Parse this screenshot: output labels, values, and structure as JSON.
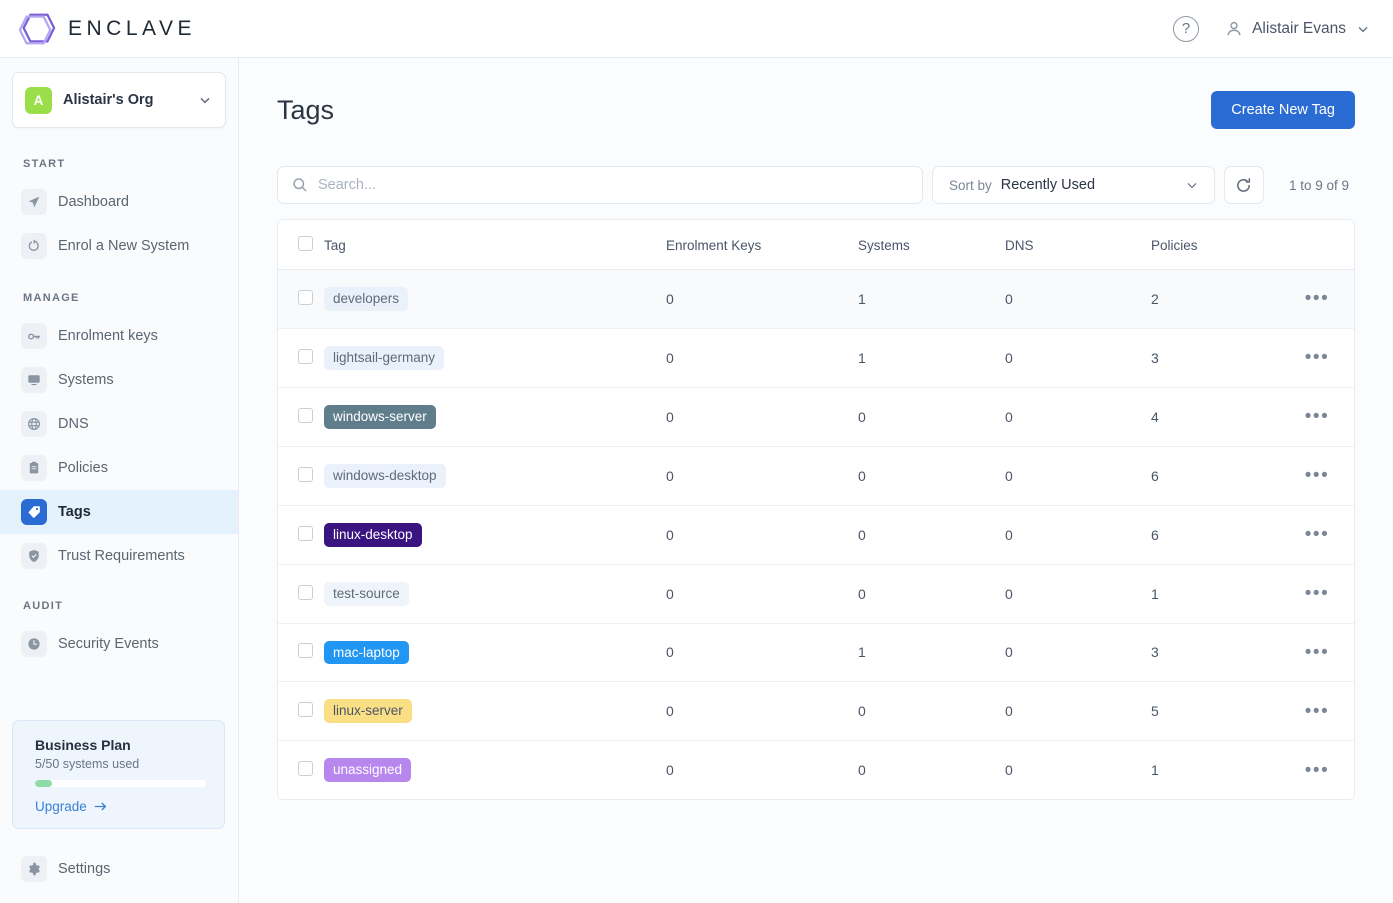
{
  "topbar": {
    "logo_text": "ENCLAVE",
    "logo_icon": "hexagon-logo-icon",
    "help_icon": "help-circle-icon",
    "user_icon": "user-avatar-icon",
    "user_name": "Alistair Evans",
    "chevron_icon": "chevron-down-icon"
  },
  "sidebar": {
    "org": {
      "avatar_letter": "A",
      "name": "Alistair's Org"
    },
    "sections": [
      {
        "label": "START",
        "items": [
          {
            "label": "Dashboard",
            "icon": "navigation-arrow-icon",
            "active": false
          },
          {
            "label": "Enrol a New System",
            "icon": "enrol-system-icon",
            "active": false
          }
        ]
      },
      {
        "label": "MANAGE",
        "items": [
          {
            "label": "Enrolment keys",
            "icon": "key-icon",
            "active": false
          },
          {
            "label": "Systems",
            "icon": "monitor-icon",
            "active": false
          },
          {
            "label": "DNS",
            "icon": "globe-icon",
            "active": false
          },
          {
            "label": "Policies",
            "icon": "clipboard-icon",
            "active": false
          },
          {
            "label": "Tags",
            "icon": "tag-icon",
            "active": true
          },
          {
            "label": "Trust Requirements",
            "icon": "shield-check-icon",
            "active": false
          }
        ]
      },
      {
        "label": "AUDIT",
        "items": [
          {
            "label": "Security Events",
            "icon": "clock-icon",
            "active": false
          }
        ]
      }
    ],
    "plan": {
      "title": "Business Plan",
      "usage": "5/50 systems used",
      "progress_percent": 10,
      "upgrade_label": "Upgrade",
      "upgrade_icon": "arrow-right-icon",
      "bar_color": "#8fdba5"
    },
    "settings": {
      "label": "Settings",
      "icon": "gear-icon"
    }
  },
  "main": {
    "title": "Tags",
    "create_button": "Create New Tag",
    "search": {
      "placeholder": "Search...",
      "value": "",
      "icon": "search-icon"
    },
    "sort": {
      "label": "Sort by",
      "value": "Recently Used",
      "icon": "chevron-down-icon"
    },
    "refresh_icon": "refresh-icon",
    "pagination": "1 to 9 of 9",
    "table": {
      "columns": [
        "Tag",
        "Enrolment Keys",
        "Systems",
        "DNS",
        "Policies"
      ],
      "rows": [
        {
          "tag": "developers",
          "enrolment_keys": "0",
          "systems": "1",
          "dns": "0",
          "policies": "2",
          "pill_bg": "#eaf1fb",
          "pill_fg": "#5f6b7a",
          "hovered": true
        },
        {
          "tag": "lightsail-germany",
          "enrolment_keys": "0",
          "systems": "1",
          "dns": "0",
          "policies": "3",
          "pill_bg": "#eaf1fb",
          "pill_fg": "#5f6b7a",
          "hovered": false
        },
        {
          "tag": "windows-server",
          "enrolment_keys": "0",
          "systems": "0",
          "dns": "0",
          "policies": "4",
          "pill_bg": "#607d8b",
          "pill_fg": "#ffffff",
          "hovered": false
        },
        {
          "tag": "windows-desktop",
          "enrolment_keys": "0",
          "systems": "0",
          "dns": "0",
          "policies": "6",
          "pill_bg": "#eaf1fb",
          "pill_fg": "#5f6b7a",
          "hovered": false
        },
        {
          "tag": "linux-desktop",
          "enrolment_keys": "0",
          "systems": "0",
          "dns": "0",
          "policies": "6",
          "pill_bg": "#3a1480",
          "pill_fg": "#ffffff",
          "hovered": false
        },
        {
          "tag": "test-source",
          "enrolment_keys": "0",
          "systems": "0",
          "dns": "0",
          "policies": "1",
          "pill_bg": "#eef4fa",
          "pill_fg": "#5f6b7a",
          "hovered": false
        },
        {
          "tag": "mac-laptop",
          "enrolment_keys": "0",
          "systems": "1",
          "dns": "0",
          "policies": "3",
          "pill_bg": "#2196f3",
          "pill_fg": "#ffffff",
          "hovered": false
        },
        {
          "tag": "linux-server",
          "enrolment_keys": "0",
          "systems": "0",
          "dns": "0",
          "policies": "5",
          "pill_bg": "#fbdf85",
          "pill_fg": "#4a5568",
          "hovered": false
        },
        {
          "tag": "unassigned",
          "enrolment_keys": "0",
          "systems": "0",
          "dns": "0",
          "policies": "1",
          "pill_bg": "#b887ee",
          "pill_fg": "#ffffff",
          "hovered": false
        }
      ],
      "row_action_icon": "more-options-icon"
    }
  },
  "colors": {
    "accent_blue": "#2b6cd4",
    "active_nav_bg": "#e4f2fd",
    "org_avatar_green": "#9ade4a"
  }
}
